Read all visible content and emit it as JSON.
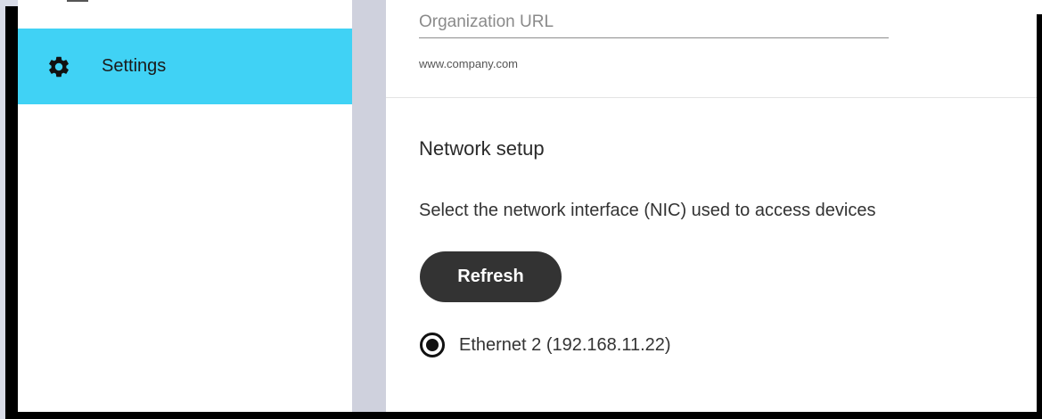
{
  "sidebar": {
    "items": [
      {
        "label": "Settings",
        "icon": "gear-icon",
        "active": true
      }
    ]
  },
  "organization": {
    "url_label": "Organization URL",
    "url_value": "www.company.com"
  },
  "network": {
    "title": "Network setup",
    "description": "Select the network interface (NIC) used to access devices",
    "refresh_label": "Refresh",
    "interfaces": [
      {
        "label": "Ethernet 2 (192.168.11.22)",
        "selected": true
      }
    ]
  },
  "colors": {
    "sidebar_active": "#40d2f5",
    "button": "#333333",
    "frame": "#000000"
  }
}
